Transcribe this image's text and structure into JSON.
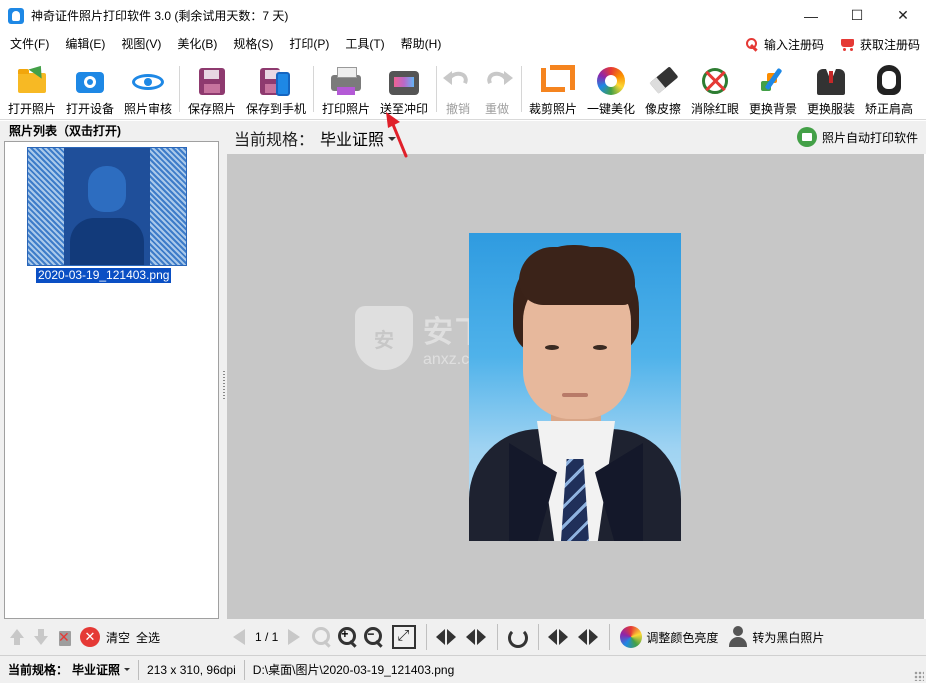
{
  "window": {
    "title": "神奇证件照片打印软件 3.0 (剩余试用天数：7 天)",
    "minimize": "—",
    "maximize": "☐",
    "close": "✕"
  },
  "menu": {
    "items": [
      "文件(F)",
      "编辑(E)",
      "视图(V)",
      "美化(B)",
      "规格(S)",
      "打印(P)",
      "工具(T)",
      "帮助(H)"
    ],
    "register": "输入注册码",
    "purchase": "获取注册码"
  },
  "toolbar": {
    "open_photo": "打开照片",
    "open_device": "打开设备",
    "review_photo": "照片审核",
    "save_photo": "保存照片",
    "save_to_phone": "保存到手机",
    "print_photo": "打印照片",
    "send_to_print": "送至冲印",
    "undo": "撤销",
    "redo": "重做",
    "crop_photo": "裁剪照片",
    "one_click_beautify": "一键美化",
    "eraser": "像皮擦",
    "remove_redeye": "消除红眼",
    "change_background": "更换背景",
    "change_clothes": "更换服装",
    "correct_shoulders": "矫正肩高"
  },
  "left_panel": {
    "header": "照片列表（双击打开)",
    "photos": [
      {
        "filename": "2020-03-19_121403.png"
      }
    ],
    "clear": "清空",
    "select_all": "全选"
  },
  "spec_header": {
    "label": "当前规格：",
    "value": "毕业证照",
    "auto_print": "照片自动打印软件"
  },
  "watermark": {
    "cn": "安下载",
    "en": "anxz.com",
    "shield_glyph": "安"
  },
  "bottom_toolbar": {
    "page_indicator": "1 / 1",
    "adjust_color": "调整颜色亮度",
    "to_black_white": "转为黑白照片"
  },
  "statusbar": {
    "spec_label": "当前规格：",
    "spec_value": "毕业证照",
    "dimensions": "213 x 310, 96dpi",
    "path": "D:\\桌面\\图片\\2020-03-19_121403.png"
  },
  "colors": {
    "accent_blue": "#1e88e5",
    "selection": "#0a4fc4",
    "canvas_bg": "#c7c7c7",
    "annotation_arrow": "#e0202a"
  }
}
